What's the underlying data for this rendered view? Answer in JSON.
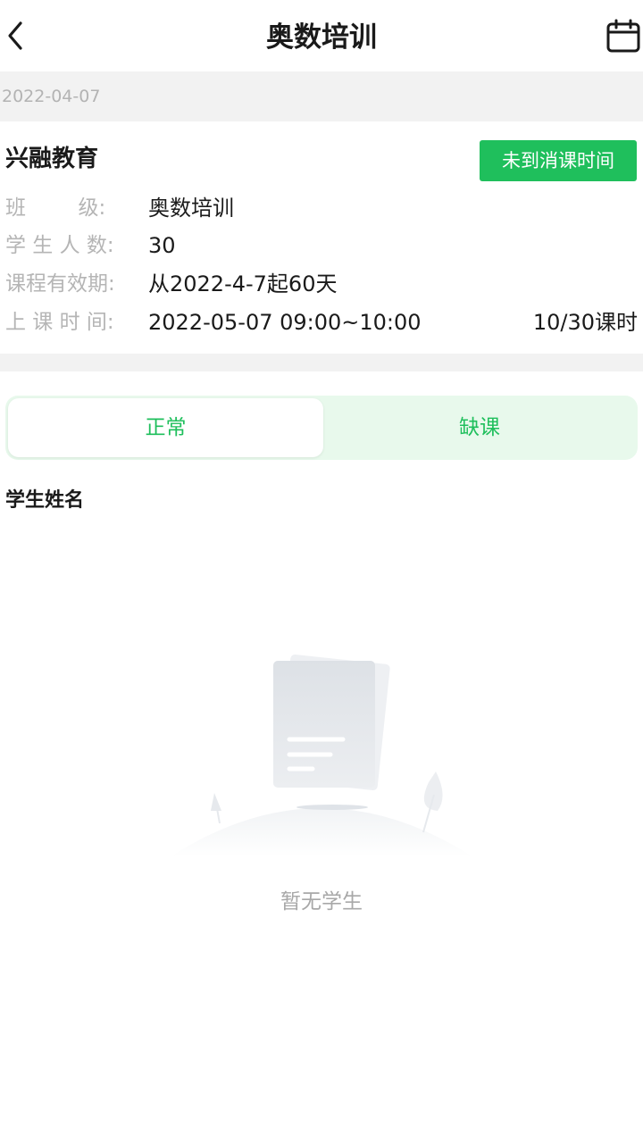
{
  "header": {
    "title": "奥数培训",
    "back_icon": "chevron-left-icon",
    "calendar_icon": "calendar-icon"
  },
  "date_bar": {
    "date": "2022-04-07"
  },
  "course": {
    "org_name": "兴融教育",
    "status_button": "未到消课时间",
    "rows": [
      {
        "label": "班        级:",
        "value": "奥数培训",
        "extra": ""
      },
      {
        "label": "学 生 人 数:",
        "value": "30",
        "extra": ""
      },
      {
        "label": "课程有效期:",
        "value": "从2022-4-7起60天",
        "extra": ""
      },
      {
        "label": "上 课 时 间:",
        "value": "2022-05-07 09:00~10:00",
        "extra": "10/30课时"
      }
    ]
  },
  "tabs": [
    {
      "label": "正常",
      "active": true
    },
    {
      "label": "缺课",
      "active": false
    }
  ],
  "section": {
    "title": "学生姓名"
  },
  "empty_state": {
    "text": "暂无学生",
    "icon": "empty-document-icon"
  },
  "colors": {
    "accent": "#1fbf5c",
    "tab_background": "#e8f9ec",
    "muted_text": "#b5b5b5",
    "divider": "#f2f2f2"
  }
}
